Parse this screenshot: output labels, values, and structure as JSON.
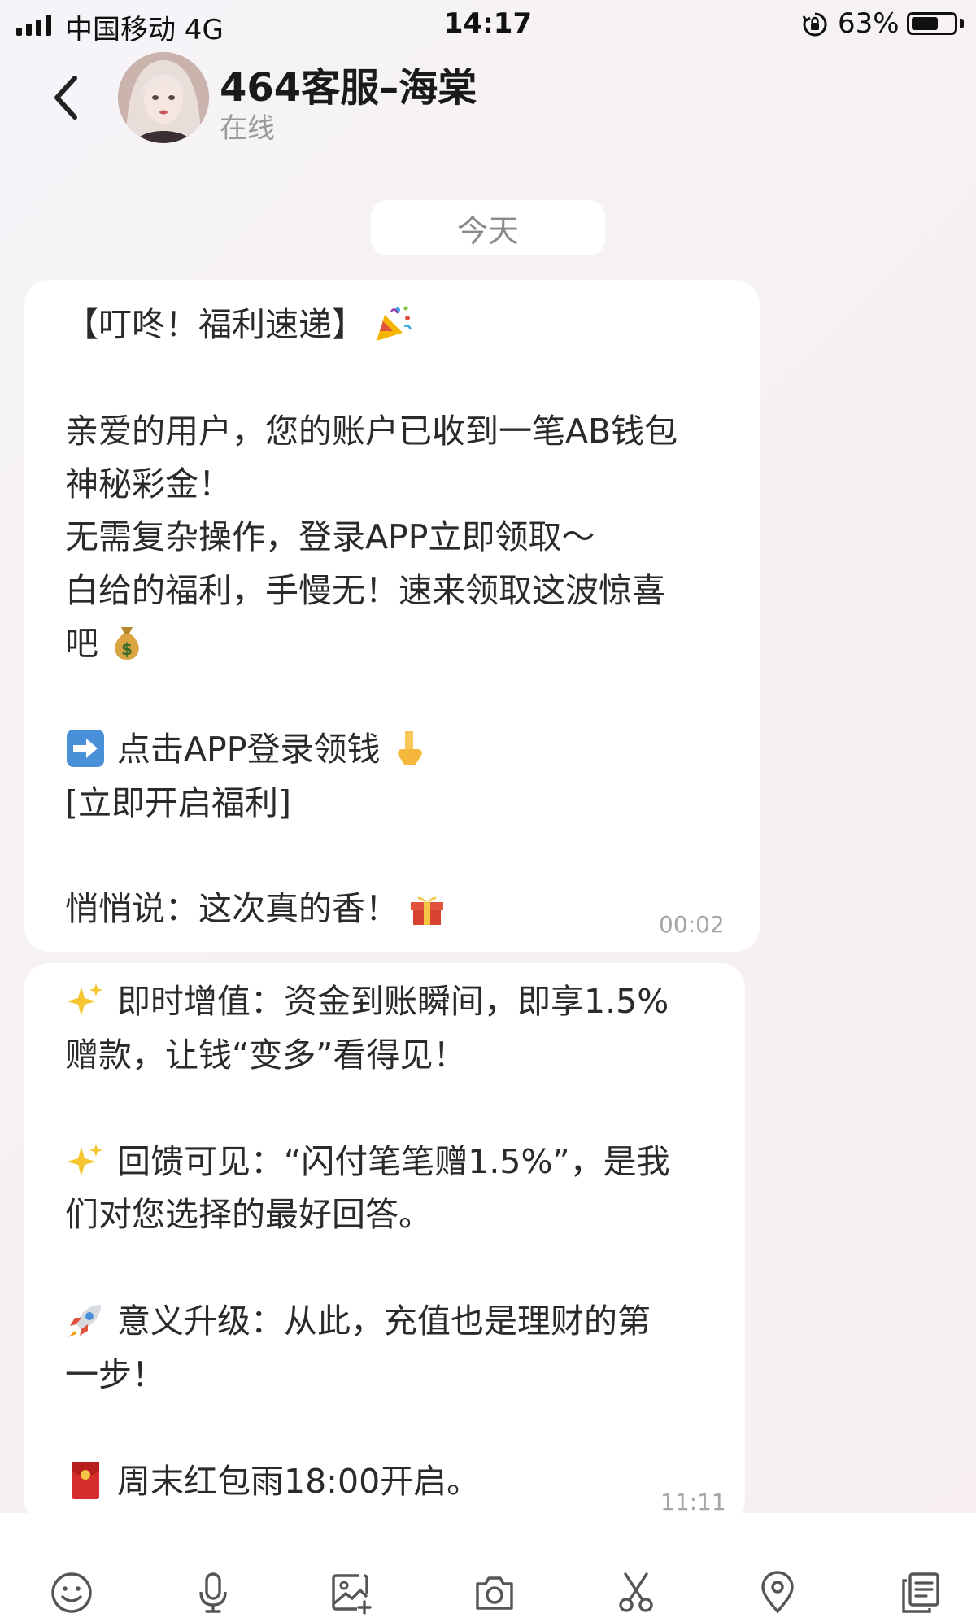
{
  "status_bar": {
    "carrier": "中国移动  4G",
    "time": "14:17",
    "battery_percent": "63%",
    "battery_level": 0.63
  },
  "header": {
    "contact_name": "464客服–海棠",
    "presence": "在线"
  },
  "date_divider": "今天",
  "messages": [
    {
      "lines": [
        {
          "text": "【叮咚！福利速递】",
          "emoji": "party-popper-icon"
        },
        {
          "text": ""
        },
        {
          "text": "亲爱的用户，您的账户已收到一笔AB钱包"
        },
        {
          "text": "神秘彩金！"
        },
        {
          "text": "无需复杂操作，登录APP立即领取～"
        },
        {
          "text": "白给的福利，手慢无！速来领取这波惊喜"
        },
        {
          "text": "吧",
          "emoji": "money-bag-icon"
        },
        {
          "text": ""
        },
        {
          "text": "点击APP登录领钱",
          "lead_emoji": "right-arrow-icon",
          "emoji": "pointing-down-icon"
        },
        {
          "text": "[立即开启福利]"
        },
        {
          "text": ""
        },
        {
          "text": "悄悄说：这次真的香！",
          "emoji": "gift-icon"
        }
      ],
      "time": "00:02"
    },
    {
      "lines": [
        {
          "text": "即时增值：资金到账瞬间，即享1.5%",
          "lead_emoji": "sparkles-icon"
        },
        {
          "text": "赠款，让钱“变多”看得见！"
        },
        {
          "text": ""
        },
        {
          "text": "回馈可见：“闪付笔笔赠1.5%”，是我",
          "lead_emoji": "sparkles-icon"
        },
        {
          "text": "们对您选择的最好回答。"
        },
        {
          "text": ""
        },
        {
          "text": "意义升级：从此，充值也是理财的第",
          "lead_emoji": "rocket-icon"
        },
        {
          "text": "一步！"
        },
        {
          "text": ""
        },
        {
          "text": "周末红包雨18:00开启。",
          "lead_emoji": "red-envelope-icon"
        }
      ],
      "time": "11:11"
    }
  ],
  "toolbar": {
    "icons": [
      "emoji-icon",
      "microphone-icon",
      "image-add-icon",
      "camera-icon",
      "scissors-icon",
      "location-icon",
      "document-icon"
    ]
  }
}
